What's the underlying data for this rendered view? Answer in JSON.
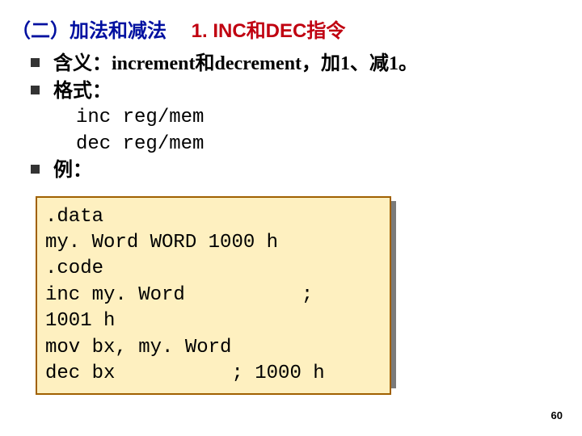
{
  "title": {
    "section": "（二）加法和减法",
    "heading": "1. INC和DEC指令"
  },
  "bullets": {
    "meaning": {
      "prefix_zh": "含义：",
      "body_en1": "increment",
      "mid_zh": "和",
      "body_en2": "decrement",
      "suffix_zh": "，加",
      "one1": "1",
      "mid2_zh": "、减",
      "one2": "1",
      "period": "。"
    },
    "format_label": "格式：",
    "format_code": "inc reg/mem\ndec reg/mem",
    "example_label": "例："
  },
  "codebox": ".data\nmy. Word WORD 1000 h\n.code\ninc my. Word          ;\n1001 h\nmov bx, my. Word\ndec bx          ; 1000 h",
  "page_number": "60"
}
